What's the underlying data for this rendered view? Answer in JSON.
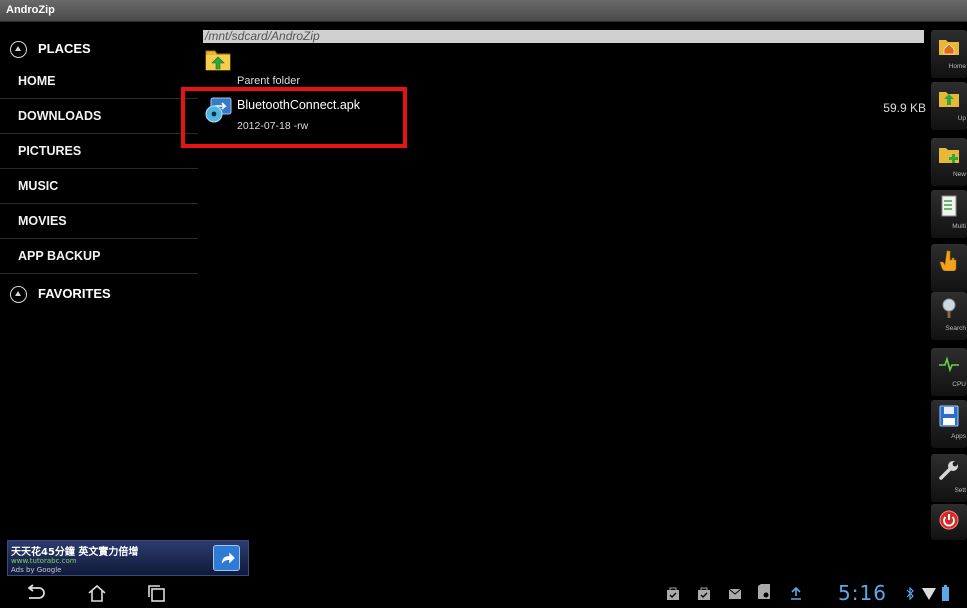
{
  "app": {
    "title": "AndroZip"
  },
  "sidebar": {
    "places_label": "PLACES",
    "items": [
      {
        "label": "HOME"
      },
      {
        "label": "DOWNLOADS"
      },
      {
        "label": "PICTURES"
      },
      {
        "label": "MUSIC"
      },
      {
        "label": "MOVIES"
      },
      {
        "label": "APP BACKUP"
      }
    ],
    "favorites_label": "FAVORITES"
  },
  "path": {
    "current": "/mnt/sdcard/AndroZip"
  },
  "files": {
    "parent": {
      "label": "Parent folder"
    },
    "items": [
      {
        "name": "BluetoothConnect.apk",
        "meta": "2012-07-18 -rw",
        "size": "59.9 KB"
      }
    ]
  },
  "toolbar": {
    "items": [
      {
        "label": "Home",
        "icon": "home-folder-icon"
      },
      {
        "label": "Up",
        "icon": "folder-up-icon"
      },
      {
        "label": "New",
        "icon": "new-folder-icon"
      },
      {
        "label": "Multi",
        "icon": "multi-select-icon"
      },
      {
        "label": "",
        "icon": "hand-pointer-icon"
      },
      {
        "label": "Search",
        "icon": "search-icon"
      },
      {
        "label": "CPU",
        "icon": "cpu-pulse-icon"
      },
      {
        "label": "Apps",
        "icon": "floppy-disk-icon"
      },
      {
        "label": "Sett",
        "icon": "wrench-icon"
      },
      {
        "label": "",
        "icon": "power-icon"
      }
    ]
  },
  "ad": {
    "headline": "天天花45分鐘 英文實力倍增",
    "url": "www.tutorabc.com",
    "attribution": "Ads by Google"
  },
  "system_bar": {
    "time": "5:16"
  },
  "colors": {
    "highlight": "#e41414",
    "clock": "#5aa8e8",
    "background": "#000000"
  }
}
